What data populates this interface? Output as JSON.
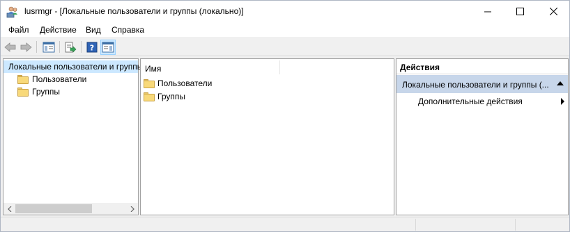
{
  "window": {
    "title": "lusrmgr - [Локальные пользователи и группы (локально)]",
    "app_icon": "users-computer-icon",
    "controls": [
      "minimize-icon",
      "maximize-icon",
      "close-icon"
    ]
  },
  "menu": {
    "items": [
      {
        "label": "Файл"
      },
      {
        "label": "Действие"
      },
      {
        "label": "Вид"
      },
      {
        "label": "Справка"
      }
    ]
  },
  "toolbar": {
    "buttons": [
      "back-arrow-icon",
      "forward-arrow-icon",
      "show-hide-console-tree-icon",
      "export-list-icon",
      "help-icon",
      "show-hide-action-pane-icon"
    ]
  },
  "tree": {
    "root_label": "Локальные пользователи и группы (локально)",
    "children": [
      {
        "label": "Пользователи"
      },
      {
        "label": "Группы"
      }
    ]
  },
  "list": {
    "column_name": "Имя",
    "rows": [
      {
        "label": "Пользователи"
      },
      {
        "label": "Группы"
      }
    ]
  },
  "actions": {
    "header": "Действия",
    "group_label": "Локальные пользователи и группы (...",
    "items": [
      {
        "label": "Дополнительные действия"
      }
    ]
  },
  "colors": {
    "selection": "#cce8ff",
    "actions_group_bg": "#c7d6ea",
    "window_bg": "#f0f0f0"
  }
}
